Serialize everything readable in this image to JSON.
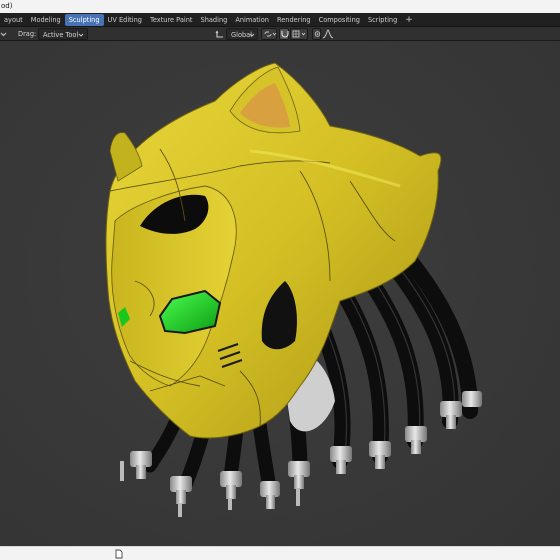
{
  "titlebar": {
    "text": "od)"
  },
  "workspaces": {
    "tabs": [
      {
        "label": "ayout"
      },
      {
        "label": "Modeling"
      },
      {
        "label": "Sculpting",
        "active": true
      },
      {
        "label": "UV Editing"
      },
      {
        "label": "Texture Paint"
      },
      {
        "label": "Shading"
      },
      {
        "label": "Animation"
      },
      {
        "label": "Rendering"
      },
      {
        "label": "Compositing"
      },
      {
        "label": "Scripting"
      }
    ],
    "add_label": "+"
  },
  "header": {
    "mode_arrow": "v",
    "drag_label": "Drag:",
    "drag_value": "Active Tool",
    "orientation_value": "Global"
  },
  "viewport": {
    "label": "ect",
    "colors": {
      "helmet_yellow": "#d9c62a",
      "eye_green": "#17c81c",
      "ear_orange": "#d9a040"
    }
  },
  "status": {
    "icon": "file-icon"
  }
}
